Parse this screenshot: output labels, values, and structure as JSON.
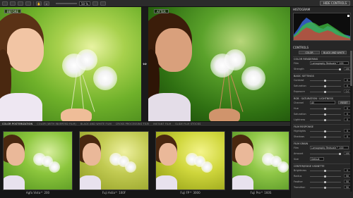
{
  "toolbar": {
    "zoom_value": "50 %",
    "hide_controls_label": "HIDE CONTROLS"
  },
  "viewer": {
    "before_label": "BEFORE",
    "after_label": "AFTER",
    "divider_icon": "compare-arrows-icon"
  },
  "thumbnails": {
    "tabs": [
      {
        "label": "COLOR POSTERIZATION",
        "active": true
      },
      {
        "label": "COLOR (WITH INVERTED FILM)",
        "active": false
      },
      {
        "label": "BLACK AND WHITE FILM",
        "active": false
      },
      {
        "label": "CROSS PROCESSING FILM",
        "active": false
      },
      {
        "label": "INSTANT FILM",
        "active": false
      },
      {
        "label": "SLIDE FILM STOCKS",
        "active": false
      }
    ],
    "items": [
      {
        "label": "Agfa Vista™ 200"
      },
      {
        "label": "Fuji Astia™ 100F"
      },
      {
        "label": "Fuji FP™ 3000"
      },
      {
        "label": "Fuji Pro™ 160S"
      }
    ]
  },
  "panel": {
    "histogram_title": "HISTOGRAM",
    "controls_title": "CONTROLS",
    "mode_buttons": [
      "COLOR",
      "BLACK AND WHITE"
    ],
    "sections": {
      "color_rendering": "COLOR RENDERING",
      "basic_settings": "BASIC SETTINGS",
      "rgb": "RGB · SATURATION · LIGHTNESS",
      "film_response": "FILM RESPONSE",
      "film_grain": "FILM GRAIN",
      "vignette": "CENTER/EDGE VIGNETTE"
    },
    "rows": {
      "film_label": "Film",
      "film_value": "Lomography Redscale™ 100",
      "strength_label": "Strength",
      "strength_value": "100",
      "contrast_label": "Contrast",
      "contrast_value": "0",
      "saturation_label": "Saturation",
      "saturation_value": "0",
      "exposure_label": "Exposure",
      "exposure_value": "0.0",
      "channel_label": "Channel",
      "channel_value": "All",
      "reset_label": "RESET",
      "hue_label": "Hue",
      "hue_value": "0",
      "sat2_label": "Saturation",
      "sat2_value": "0",
      "lightness_label": "Lightness",
      "lightness_value": "0",
      "highlights_label": "Highlights",
      "highlights_value": "0",
      "shadows_label": "Shadows",
      "shadows_value": "0",
      "grain_film_label": "Film",
      "grain_film_value": "Lomography Redscale™ 100",
      "amount_label": "Amount",
      "amount_value": "100",
      "size_label": "Size",
      "size_value": "Default",
      "brightness_label": "Brightness",
      "brightness_value": "0",
      "radius_label": "Radius",
      "radius_value": "50",
      "feather_label": "Feather",
      "feather_value": "50",
      "transition_label": "Transition",
      "transition_value": "50"
    }
  }
}
